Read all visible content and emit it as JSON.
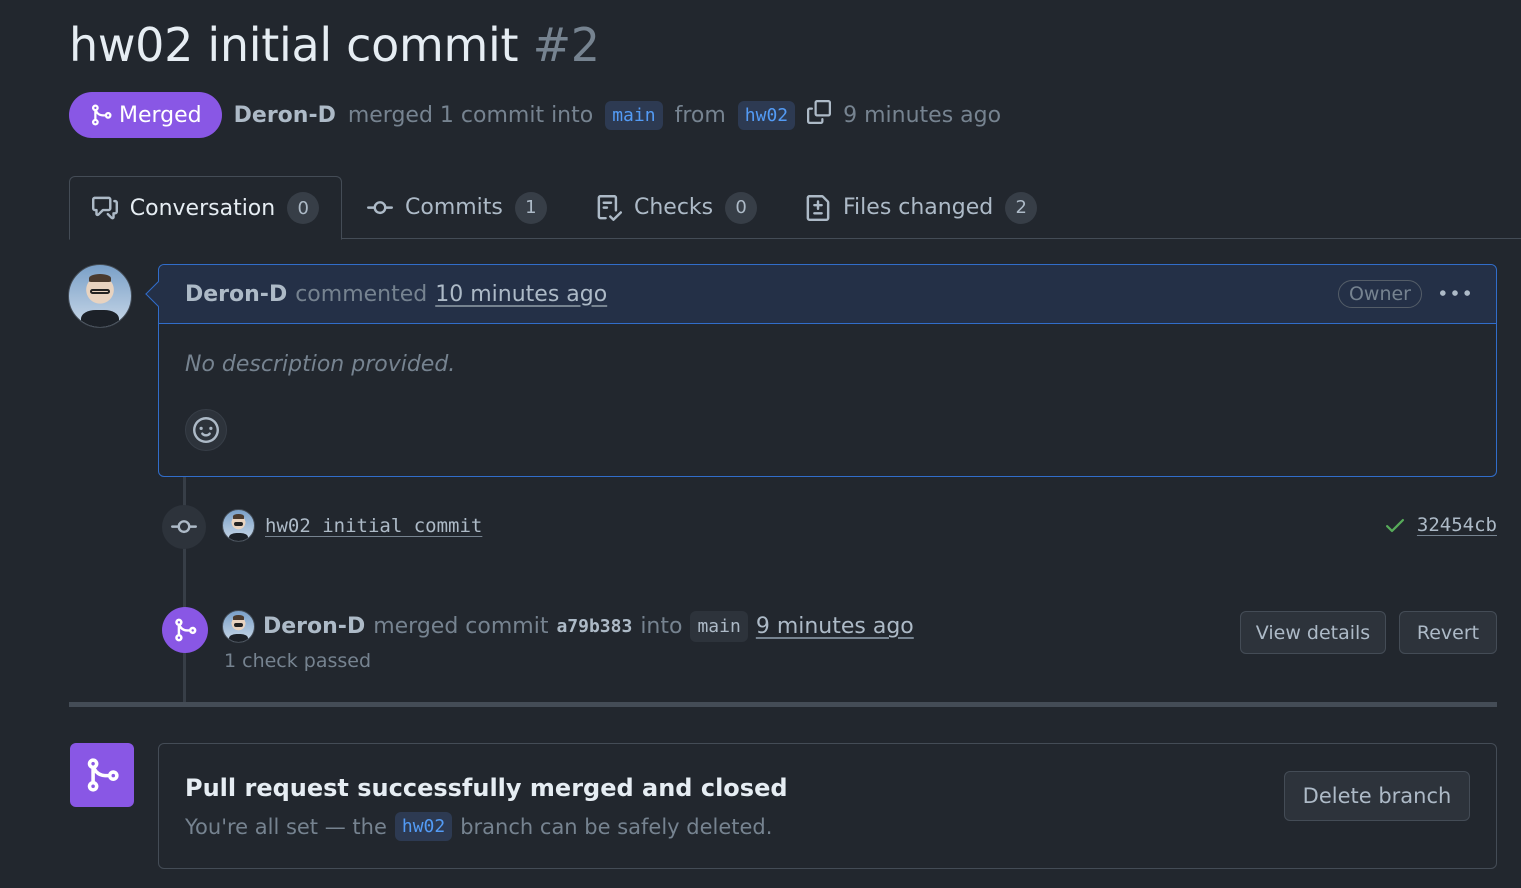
{
  "pr": {
    "title": "hw02 initial commit",
    "number": "#2",
    "state": "Merged",
    "author": "Deron-D",
    "merged_text": "merged 1 commit into",
    "base_branch": "main",
    "from_text": "from",
    "head_branch": "hw02",
    "time_ago": "9 minutes ago"
  },
  "tabs": [
    {
      "label": "Conversation",
      "count": "0",
      "icon": "comment-discussion-icon"
    },
    {
      "label": "Commits",
      "count": "1",
      "icon": "git-commit-icon"
    },
    {
      "label": "Checks",
      "count": "0",
      "icon": "checklist-icon"
    },
    {
      "label": "Files changed",
      "count": "2",
      "icon": "file-diff-icon"
    }
  ],
  "comment": {
    "author": "Deron-D",
    "action": "commented",
    "time": "10 minutes ago",
    "role": "Owner",
    "body": "No description provided."
  },
  "commit": {
    "message": "hw02 initial commit",
    "sha": "32454cb",
    "status": "success"
  },
  "merge_event": {
    "author": "Deron-D",
    "action": "merged commit",
    "sha": "a79b383",
    "into_text": "into",
    "branch": "main",
    "time": "9 minutes ago",
    "checks": "1 check passed",
    "view_details_label": "View details",
    "revert_label": "Revert"
  },
  "merged_box": {
    "title": "Pull request successfully merged and closed",
    "sub_prefix": "You're all set — the",
    "branch": "hw02",
    "sub_suffix": "branch can be safely deleted.",
    "delete_label": "Delete branch"
  },
  "colors": {
    "background": "#22272e",
    "merged_purple": "#8957e5",
    "accent_blue": "#316dca",
    "success_green": "#57ab5a"
  }
}
